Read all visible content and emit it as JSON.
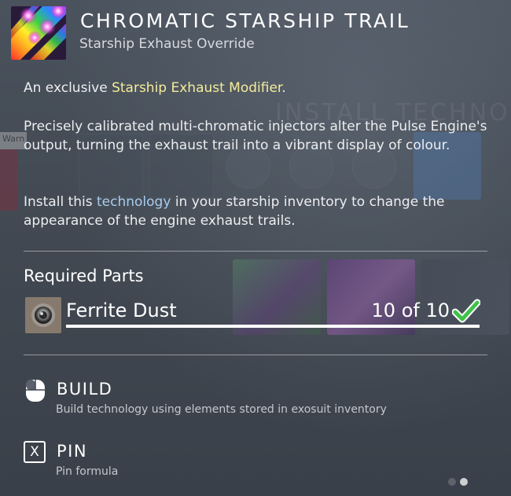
{
  "item": {
    "title": "CHROMATIC STARSHIP TRAIL",
    "subtitle": "Starship Exhaust Override",
    "icon": "rainbow-exhaust-icon"
  },
  "description": {
    "line1_prefix": "An exclusive ",
    "line1_highlight": "Starship Exhaust Modifier",
    "line1_suffix": ".",
    "paragraph2": "Precisely calibrated multi-chromatic injectors alter the Pulse Engine's output, turning the exhaust trail into a vibrant display of colour.",
    "paragraph3_prefix": "Install this ",
    "paragraph3_highlight": "technology",
    "paragraph3_suffix": " in your starship inventory to change the appearance of the engine exhaust trails."
  },
  "required_parts": {
    "heading": "Required Parts",
    "items": [
      {
        "name": "Ferrite Dust",
        "count": "10 of 10",
        "progress": 1.0,
        "icon": "ferrite-dust-icon",
        "status_icon": "checkmark-icon"
      }
    ]
  },
  "actions": [
    {
      "label": "BUILD",
      "description": "Build technology using elements stored in exosuit inventory",
      "icon": "mouse-hold-icon"
    },
    {
      "label": "PIN",
      "description": "Pin formula",
      "key": "X"
    }
  ],
  "pagination": {
    "current": 2,
    "total": 2
  },
  "colors": {
    "highlight_yellow": "#f5ec9a",
    "highlight_blue": "#a9cdee",
    "check_green": "#3fc24a"
  }
}
